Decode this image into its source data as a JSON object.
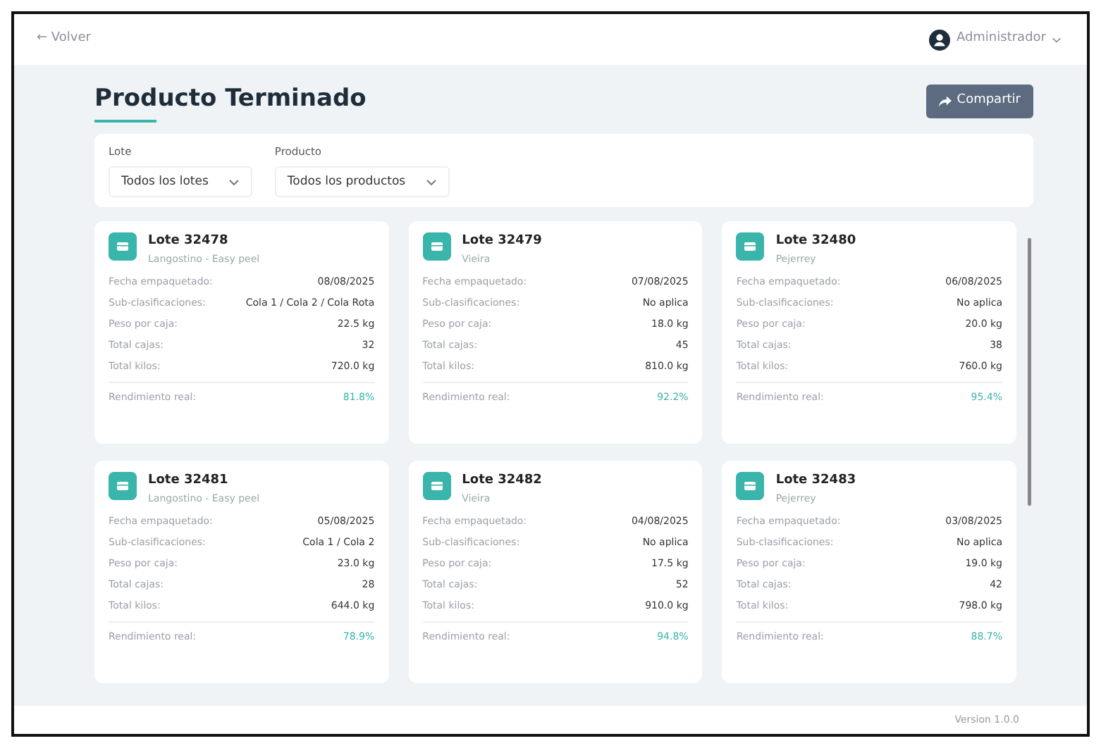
{
  "top_bar": {
    "back_link": "← Volver",
    "user": "Administrador"
  },
  "header": {
    "title": "Producto Terminado",
    "share_button": "Compartir"
  },
  "filters": [
    {
      "label": "Lote",
      "value": "Todos los lotes"
    },
    {
      "label": "Producto",
      "value": "Todos los productos"
    }
  ],
  "lots": [
    {
      "title": "Lote 32478",
      "product": "Langostino - Easy peel",
      "fields": [
        {
          "label": "Fecha empaquetado:",
          "value": "08/08/2025"
        },
        {
          "label": "Sub-clasificaciones:",
          "value": "Cola 1 / Cola 2 / Cola Rota"
        },
        {
          "label": "Peso por caja:",
          "value": "22.5 kg"
        },
        {
          "label": "Total cajas:",
          "value": "32"
        },
        {
          "label": "Total kilos:",
          "value": "720.0 kg"
        }
      ],
      "yield_label": "Rendimiento real:",
      "yield": "81.8%"
    },
    {
      "title": "Lote 32479",
      "product": "Vieira",
      "fields": [
        {
          "label": "Fecha empaquetado:",
          "value": "07/08/2025"
        },
        {
          "label": "Sub-clasificaciones:",
          "value": "No aplica"
        },
        {
          "label": "Peso por caja:",
          "value": "18.0 kg"
        },
        {
          "label": "Total cajas:",
          "value": "45"
        },
        {
          "label": "Total kilos:",
          "value": "810.0 kg"
        }
      ],
      "yield_label": "Rendimiento real:",
      "yield": "92.2%"
    },
    {
      "title": "Lote 32480",
      "product": "Pejerrey",
      "fields": [
        {
          "label": "Fecha empaquetado:",
          "value": "06/08/2025"
        },
        {
          "label": "Sub-clasificaciones:",
          "value": "No aplica"
        },
        {
          "label": "Peso por caja:",
          "value": "20.0 kg"
        },
        {
          "label": "Total cajas:",
          "value": "38"
        },
        {
          "label": "Total kilos:",
          "value": "760.0 kg"
        }
      ],
      "yield_label": "Rendimiento real:",
      "yield": "95.4%"
    },
    {
      "title": "Lote 32481",
      "product": "Langostino - Easy peel",
      "fields": [
        {
          "label": "Fecha empaquetado:",
          "value": "05/08/2025"
        },
        {
          "label": "Sub-clasificaciones:",
          "value": "Cola 1 / Cola 2"
        },
        {
          "label": "Peso por caja:",
          "value": "23.0 kg"
        },
        {
          "label": "Total cajas:",
          "value": "28"
        },
        {
          "label": "Total kilos:",
          "value": "644.0 kg"
        }
      ],
      "yield_label": "Rendimiento real:",
      "yield": "78.9%"
    },
    {
      "title": "Lote 32482",
      "product": "Vieira",
      "fields": [
        {
          "label": "Fecha empaquetado:",
          "value": "04/08/2025"
        },
        {
          "label": "Sub-clasificaciones:",
          "value": "No aplica"
        },
        {
          "label": "Peso por caja:",
          "value": "17.5 kg"
        },
        {
          "label": "Total cajas:",
          "value": "52"
        },
        {
          "label": "Total kilos:",
          "value": "910.0 kg"
        }
      ],
      "yield_label": "Rendimiento real:",
      "yield": "94.8%"
    },
    {
      "title": "Lote 32483",
      "product": "Pejerrey",
      "fields": [
        {
          "label": "Fecha empaquetado:",
          "value": "03/08/2025"
        },
        {
          "label": "Sub-clasificaciones:",
          "value": "No aplica"
        },
        {
          "label": "Peso por caja:",
          "value": "19.0 kg"
        },
        {
          "label": "Total cajas:",
          "value": "42"
        },
        {
          "label": "Total kilos:",
          "value": "798.0 kg"
        }
      ],
      "yield_label": "Rendimiento real:",
      "yield": "88.7%"
    }
  ],
  "footer": {
    "version": "Version 1.0.0"
  }
}
